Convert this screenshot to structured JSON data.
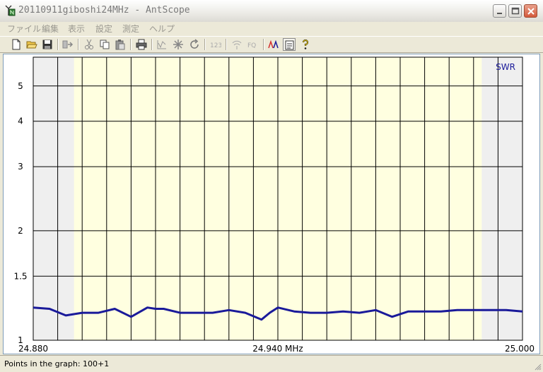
{
  "window": {
    "title": "20110911giboshi24MHz - AntScope",
    "controls": [
      "minimize",
      "maximize",
      "close"
    ]
  },
  "menu": {
    "items": [
      "ファイル",
      "編集",
      "表示",
      "設定",
      "測定",
      "ヘルプ"
    ]
  },
  "toolbar": {
    "buttons": [
      {
        "icon": "new-file-icon"
      },
      {
        "icon": "open-folder-icon"
      },
      {
        "icon": "save-icon"
      },
      {
        "icon": "export-icon"
      },
      {
        "icon": "cut-icon"
      },
      {
        "icon": "copy-icon"
      },
      {
        "icon": "paste-icon"
      },
      {
        "icon": "print-icon"
      },
      {
        "icon": "scan-icon"
      },
      {
        "icon": "marker-icon"
      },
      {
        "icon": "refresh-icon"
      },
      {
        "icon": "number-icon",
        "label": "123"
      },
      {
        "icon": "wireless-icon"
      },
      {
        "icon": "frequency-icon",
        "label": "FQ"
      },
      {
        "icon": "compare-icon"
      },
      {
        "icon": "notes-icon"
      },
      {
        "icon": "help-icon"
      }
    ]
  },
  "chart_data": {
    "type": "line",
    "series": [
      {
        "name": "SWR",
        "x": [
          24.88,
          24.884,
          24.888,
          24.892,
          24.896,
          24.9,
          24.904,
          24.908,
          24.91,
          24.912,
          24.916,
          24.92,
          24.924,
          24.928,
          24.932,
          24.936,
          24.938,
          24.94,
          24.944,
          24.948,
          24.952,
          24.956,
          24.96,
          24.964,
          24.968,
          24.972,
          24.976,
          24.98,
          24.984,
          24.988,
          24.992,
          24.996,
          25.0
        ],
        "y": [
          1.23,
          1.22,
          1.17,
          1.19,
          1.19,
          1.22,
          1.16,
          1.23,
          1.22,
          1.22,
          1.19,
          1.19,
          1.19,
          1.21,
          1.19,
          1.14,
          1.19,
          1.23,
          1.2,
          1.19,
          1.19,
          1.2,
          1.19,
          1.21,
          1.16,
          1.2,
          1.2,
          1.2,
          1.21,
          1.21,
          1.21,
          1.21,
          1.2
        ]
      }
    ],
    "x_ticks": [
      "24.880",
      "24.940 MHz",
      "25.000"
    ],
    "y_ticks": [
      "1",
      "1.5",
      "2",
      "3",
      "4",
      "5"
    ],
    "y_tick_values": [
      1,
      1.5,
      2,
      3,
      4,
      5
    ],
    "xlim": [
      24.88,
      25.0
    ],
    "ylim": [
      1,
      6
    ],
    "y_scale": "log",
    "band_edges": [
      24.89,
      24.99
    ],
    "band_color": "#ffffe0",
    "outside_band_color": "#efefef",
    "line_color": "#1a1a9a",
    "grid": true,
    "legend": "top-right"
  },
  "status": {
    "text": "Points in the graph: 100+1"
  }
}
